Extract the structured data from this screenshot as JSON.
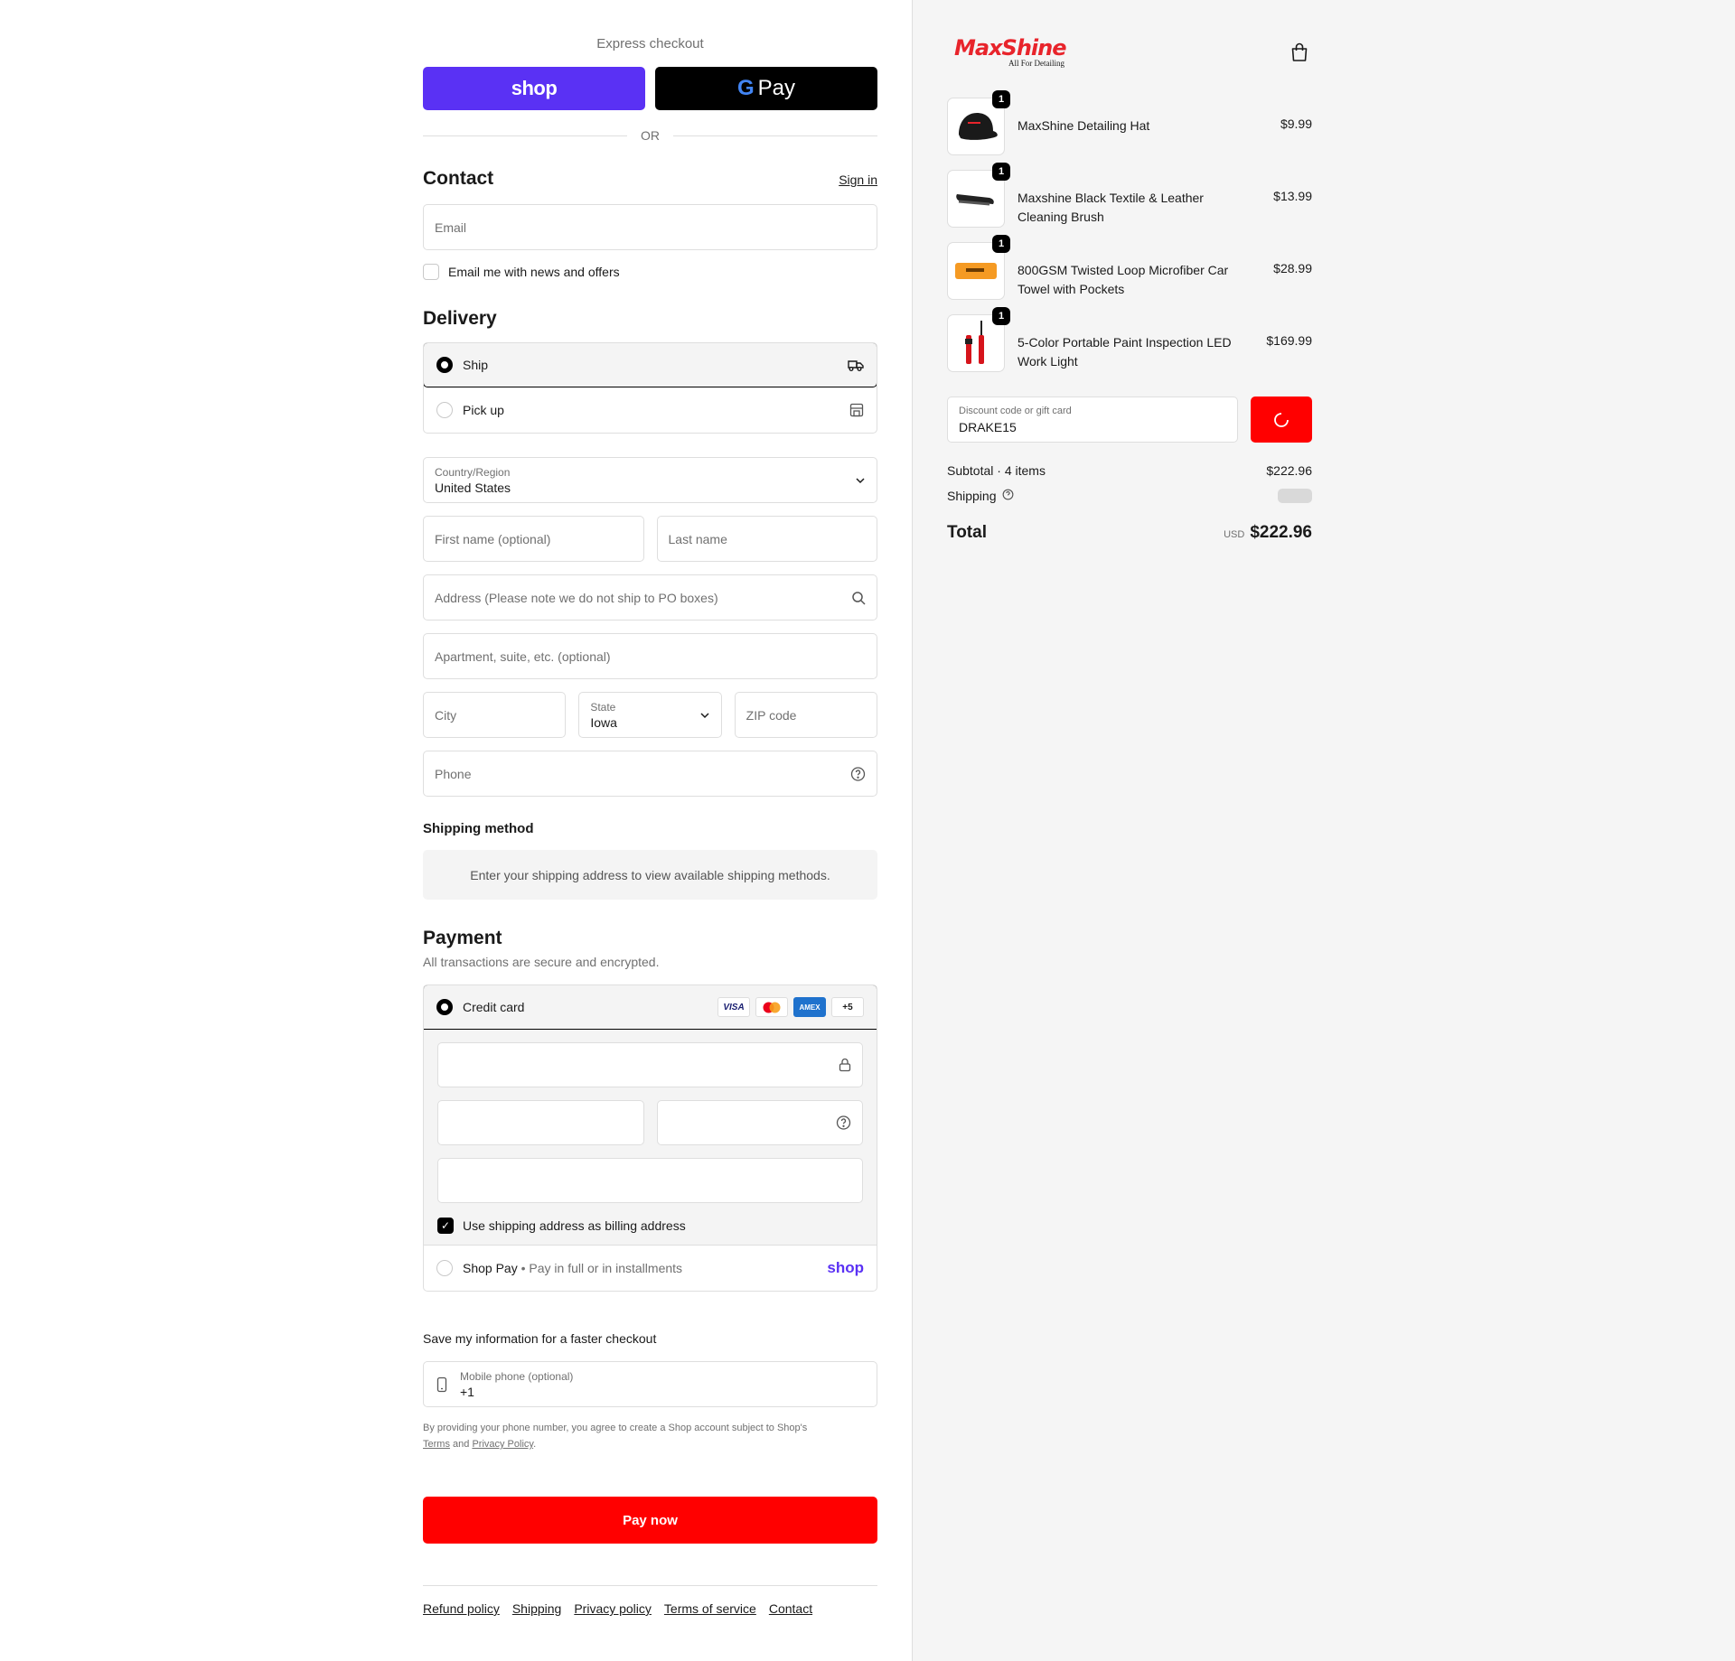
{
  "express": {
    "title": "Express checkout",
    "shop_label": "shop",
    "gpay_label": "Pay",
    "or": "OR"
  },
  "contact": {
    "title": "Contact",
    "sign_in": "Sign in",
    "email_placeholder": "Email",
    "news_label": "Email me with news and offers"
  },
  "delivery": {
    "title": "Delivery",
    "options": [
      "Ship",
      "Pick up"
    ],
    "country_label": "Country/Region",
    "country_value": "United States",
    "first_name_placeholder": "First name (optional)",
    "last_name_placeholder": "Last name",
    "address_placeholder": "Address (Please note we do not ship to PO boxes)",
    "apartment_placeholder": "Apartment, suite, etc. (optional)",
    "city_placeholder": "City",
    "state_label": "State",
    "state_value": "Iowa",
    "zip_placeholder": "ZIP code",
    "phone_placeholder": "Phone"
  },
  "shipping_method": {
    "title": "Shipping method",
    "notice": "Enter your shipping address to view available shipping methods."
  },
  "payment": {
    "title": "Payment",
    "subtitle": "All transactions are secure and encrypted.",
    "credit_card_label": "Credit card",
    "brands": [
      "VISA",
      "AMEX",
      "+5"
    ],
    "billing_label": "Use shipping address as billing address",
    "shop_pay_label": "Shop Pay",
    "shop_pay_sub": "• Pay in full or in installments",
    "shop_pay_logo": "shop"
  },
  "save_info": {
    "title": "Save my information for a faster checkout",
    "mobile_label": "Mobile phone (optional)",
    "mobile_value": "+1",
    "legal_prefix": "By providing your phone number, you agree to create a Shop account subject to Shop's",
    "terms": "Terms",
    "and": "and",
    "privacy": "Privacy Policy",
    "period": "."
  },
  "pay_now": "Pay now",
  "footer_links": [
    "Refund policy",
    "Shipping",
    "Privacy policy",
    "Terms of service",
    "Contact"
  ],
  "store": {
    "logo_text": "MaxShine",
    "logo_tagline": "All For Detailing",
    "brand_red": "#ff0000",
    "shop_purple": "#5a31f4"
  },
  "cart": {
    "items": [
      {
        "name": "MaxShine Detailing Hat",
        "price": "$9.99",
        "qty": "1"
      },
      {
        "name": "Maxshine Black Textile & Leather Cleaning Brush",
        "price": "$13.99",
        "qty": "1"
      },
      {
        "name": "800GSM Twisted Loop Microfiber Car Towel with Pockets",
        "price": "$28.99",
        "qty": "1"
      },
      {
        "name": "5-Color Portable Paint Inspection LED Work Light",
        "price": "$169.99",
        "qty": "1"
      }
    ],
    "discount_label": "Discount code or gift card",
    "discount_value": "DRAKE15",
    "subtotal_label": "Subtotal · 4 items",
    "subtotal_value": "$222.96",
    "shipping_label": "Shipping",
    "total_label": "Total",
    "currency": "USD",
    "total_value": "$222.96"
  }
}
